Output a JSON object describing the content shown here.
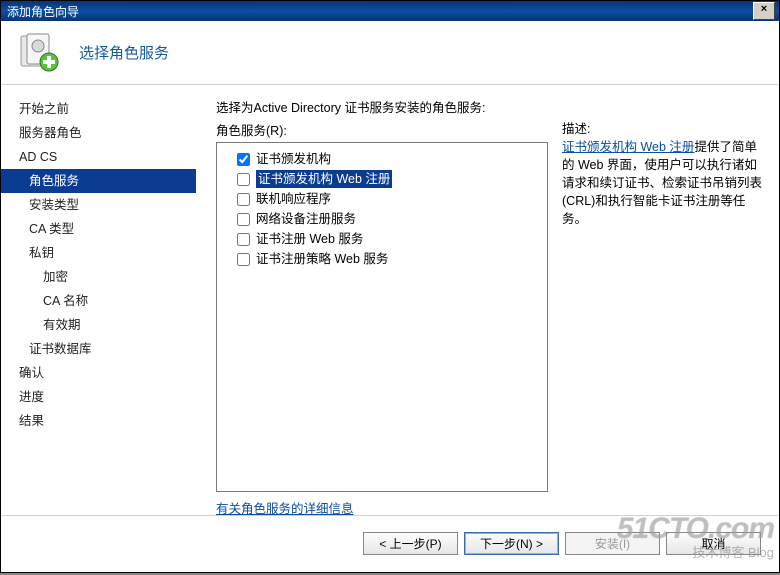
{
  "window": {
    "title": "添加角色向导",
    "close": "×"
  },
  "header": {
    "title": "选择角色服务"
  },
  "sidebar": {
    "items": [
      {
        "label": "开始之前",
        "level": 1
      },
      {
        "label": "服务器角色",
        "level": 1
      },
      {
        "label": "AD CS",
        "level": 1
      },
      {
        "label": "角色服务",
        "level": 2,
        "selected": true
      },
      {
        "label": "安装类型",
        "level": 2
      },
      {
        "label": "CA 类型",
        "level": 2
      },
      {
        "label": "私钥",
        "level": 2
      },
      {
        "label": "加密",
        "level": 3
      },
      {
        "label": "CA 名称",
        "level": 3
      },
      {
        "label": "有效期",
        "level": 3
      },
      {
        "label": "证书数据库",
        "level": 2
      },
      {
        "label": "确认",
        "level": 1
      },
      {
        "label": "进度",
        "level": 1
      },
      {
        "label": "结果",
        "level": 1
      }
    ]
  },
  "main": {
    "prompt": "选择为Active Directory 证书服务安装的角色服务:",
    "roles_label": "角色服务(R):",
    "roles": [
      {
        "label": "证书颁发机构",
        "checked": true,
        "selected": false
      },
      {
        "label": "证书颁发机构 Web 注册",
        "checked": false,
        "selected": true
      },
      {
        "label": "联机响应程序",
        "checked": false,
        "selected": false
      },
      {
        "label": "网络设备注册服务",
        "checked": false,
        "selected": false
      },
      {
        "label": "证书注册 Web 服务",
        "checked": false,
        "selected": false
      },
      {
        "label": "证书注册策略 Web 服务",
        "checked": false,
        "selected": false
      }
    ],
    "description": {
      "heading": "描述:",
      "link_text": "证书颁发机构 Web 注册",
      "body": "提供了简单的 Web 界面，使用户可以执行诸如请求和续订证书、检索证书吊销列表(CRL)和执行智能卡证书注册等任务。"
    },
    "details_link": "有关角色服务的详细信息"
  },
  "footer": {
    "prev": "< 上一步(P)",
    "next": "下一步(N) >",
    "install": "安装(I)",
    "cancel": "取消"
  },
  "watermark": {
    "big": "51CTO.com",
    "sub": "技术博客   Blog"
  }
}
